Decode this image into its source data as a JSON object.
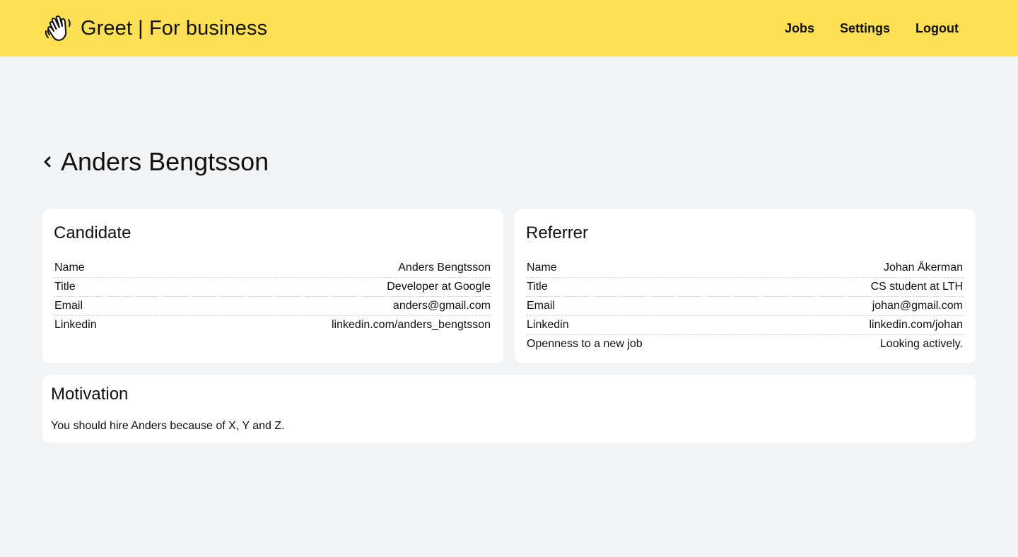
{
  "header": {
    "brand_title": "Greet | For business",
    "brand_icon": "waving-hand-icon",
    "nav": [
      "Jobs",
      "Settings",
      "Logout"
    ],
    "background_color": "#ffe054"
  },
  "page": {
    "title": "Anders Bengtsson",
    "back_icon": "chevron-left-icon"
  },
  "candidate": {
    "heading": "Candidate",
    "rows": [
      {
        "label": "Name",
        "value": "Anders Bengtsson"
      },
      {
        "label": "Title",
        "value": "Developer at Google"
      },
      {
        "label": "Email",
        "value": "anders@gmail.com"
      },
      {
        "label": "Linkedin",
        "value": "linkedin.com/anders_bengtsson"
      }
    ]
  },
  "referrer": {
    "heading": "Referrer",
    "rows": [
      {
        "label": "Name",
        "value": "Johan Åkerman"
      },
      {
        "label": "Title",
        "value": "CS student at LTH"
      },
      {
        "label": "Email",
        "value": "johan@gmail.com"
      },
      {
        "label": "Linkedin",
        "value": "linkedin.com/johan"
      },
      {
        "label": "Openness to a new job",
        "value": "Looking actively."
      }
    ]
  },
  "motivation": {
    "heading": "Motivation",
    "text": "You should hire Anders because of X, Y and Z."
  }
}
